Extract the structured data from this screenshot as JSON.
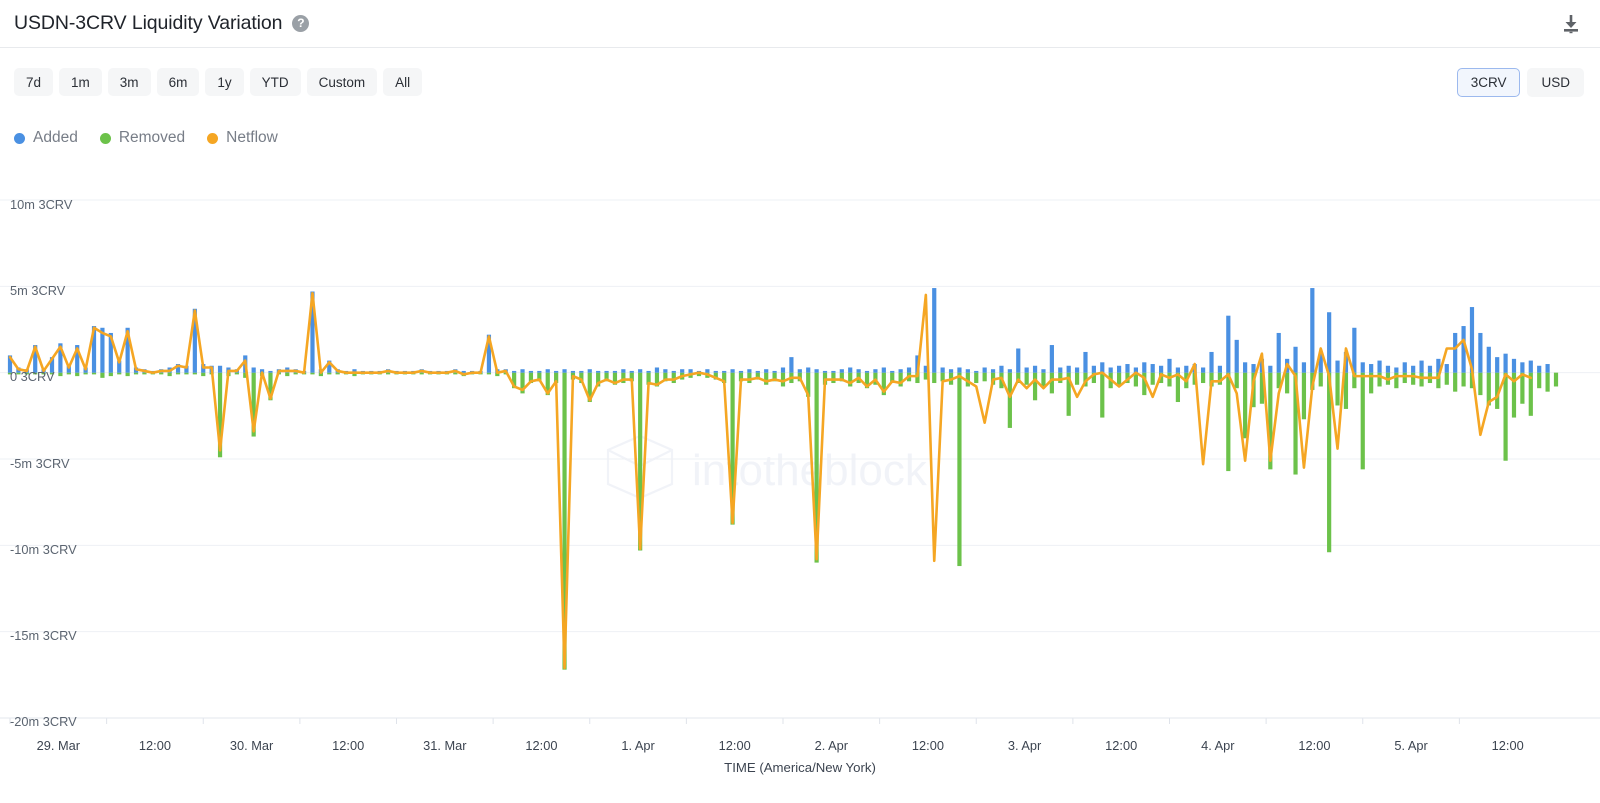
{
  "header": {
    "title": "USDN-3CRV Liquidity Variation",
    "help_icon": "help-circle-icon",
    "download_icon": "download-icon"
  },
  "controls": {
    "ranges": [
      {
        "label": "7d",
        "active": false
      },
      {
        "label": "1m",
        "active": false
      },
      {
        "label": "3m",
        "active": false
      },
      {
        "label": "6m",
        "active": false
      },
      {
        "label": "1y",
        "active": false
      },
      {
        "label": "YTD",
        "active": false
      },
      {
        "label": "Custom",
        "active": false
      },
      {
        "label": "All",
        "active": false
      }
    ],
    "units": [
      {
        "label": "3CRV",
        "active": true
      },
      {
        "label": "USD",
        "active": false
      }
    ]
  },
  "legend": [
    {
      "label": "Added",
      "color": "#4a90e2"
    },
    {
      "label": "Removed",
      "color": "#6cc24a"
    },
    {
      "label": "Netflow",
      "color": "#f5a623"
    }
  ],
  "watermark": {
    "text": "intotheblock",
    "color": "#f2f4f8"
  },
  "colors": {
    "added": "#4a90e2",
    "removed": "#6cc24a",
    "netflow": "#f5a623",
    "grid": "#eef0f4",
    "axis_text": "#3c4450",
    "background": "#ffffff"
  },
  "chart_data": {
    "type": "bar",
    "title": "USDN-3CRV Liquidity Variation",
    "subtitle": "",
    "xlabel": "TIME (America/New York)",
    "ylabel": "3CRV",
    "unit": "3CRV",
    "timezone": "America/New York",
    "grid": true,
    "legend_position": "top-left",
    "ylim": [
      -20000000,
      10000000
    ],
    "ytick_values": [
      10000000,
      5000000,
      0,
      -5000000,
      -10000000,
      -15000000,
      -20000000
    ],
    "ytick_labels": [
      "10m 3CRV",
      "5m 3CRV",
      "0 3CRV",
      "-5m 3CRV",
      "-10m 3CRV",
      "-15m 3CRV",
      "-20m 3CRV"
    ],
    "xtick_labels": [
      "29. Mar",
      "12:00",
      "30. Mar",
      "12:00",
      "31. Mar",
      "12:00",
      "1. Apr",
      "12:00",
      "2. Apr",
      "12:00",
      "3. Apr",
      "12:00",
      "4. Apr",
      "12:00",
      "5. Apr",
      "12:00"
    ],
    "x_start": "29. Mar 00:00",
    "x_end": "5. Apr 23:00",
    "x_interval_hours": 1,
    "n_points": 190,
    "series": [
      {
        "name": "Added",
        "type": "bar",
        "color": "#4a90e2",
        "values": [
          1000000,
          300000,
          200000,
          1600000,
          200000,
          900000,
          1700000,
          400000,
          1600000,
          300000,
          2700000,
          2600000,
          2300000,
          700000,
          2600000,
          300000,
          200000,
          100000,
          200000,
          300000,
          500000,
          400000,
          3700000,
          500000,
          400000,
          400000,
          300000,
          200000,
          1000000,
          300000,
          200000,
          100000,
          200000,
          300000,
          200000,
          100000,
          4700000,
          200000,
          700000,
          200000,
          100000,
          200000,
          100000,
          100000,
          100000,
          200000,
          100000,
          100000,
          100000,
          200000,
          100000,
          100000,
          100000,
          200000,
          100000,
          100000,
          100000,
          2200000,
          200000,
          200000,
          100000,
          200000,
          100000,
          100000,
          200000,
          100000,
          200000,
          100000,
          100000,
          200000,
          100000,
          100000,
          100000,
          200000,
          100000,
          200000,
          100000,
          300000,
          200000,
          100000,
          200000,
          200000,
          100000,
          200000,
          100000,
          100000,
          200000,
          100000,
          200000,
          100000,
          200000,
          100000,
          300000,
          900000,
          200000,
          300000,
          200000,
          100000,
          100000,
          200000,
          300000,
          200000,
          100000,
          200000,
          300000,
          100000,
          200000,
          300000,
          1000000,
          400000,
          4900000,
          300000,
          200000,
          300000,
          200000,
          100000,
          300000,
          200000,
          400000,
          200000,
          1400000,
          300000,
          400000,
          200000,
          1600000,
          300000,
          400000,
          300000,
          1200000,
          400000,
          600000,
          300000,
          400000,
          500000,
          300000,
          600000,
          500000,
          400000,
          800000,
          300000,
          400000,
          500000,
          300000,
          1200000,
          400000,
          3300000,
          1900000,
          600000,
          500000,
          800000,
          400000,
          2300000,
          800000,
          1500000,
          600000,
          4900000,
          1100000,
          3500000,
          700000,
          1200000,
          2600000,
          600000,
          500000,
          700000,
          400000,
          300000,
          600000,
          400000,
          700000,
          400000,
          800000,
          500000,
          2300000,
          2700000,
          3800000,
          2300000,
          1500000,
          900000,
          1100000,
          800000,
          600000,
          700000,
          400000,
          500000
        ]
      },
      {
        "name": "Removed",
        "type": "bar",
        "color": "#6cc24a",
        "values": [
          -100000,
          -100000,
          -100000,
          -100000,
          -100000,
          -100000,
          -200000,
          -100000,
          -200000,
          -100000,
          -100000,
          -300000,
          -200000,
          -100000,
          -200000,
          -100000,
          -100000,
          -100000,
          -100000,
          -200000,
          -100000,
          -100000,
          -100000,
          -200000,
          -100000,
          -4900000,
          -200000,
          -100000,
          -300000,
          -3700000,
          -200000,
          -1600000,
          -100000,
          -200000,
          -100000,
          -100000,
          -100000,
          -200000,
          -100000,
          -100000,
          -100000,
          -200000,
          -100000,
          -100000,
          -100000,
          -100000,
          -100000,
          -100000,
          -100000,
          -100000,
          -100000,
          -100000,
          -100000,
          -100000,
          -200000,
          -100000,
          -100000,
          -100000,
          -200000,
          -100000,
          -900000,
          -1200000,
          -600000,
          -500000,
          -1300000,
          -600000,
          -17200000,
          -400000,
          -600000,
          -1700000,
          -800000,
          -500000,
          -700000,
          -600000,
          -500000,
          -10300000,
          -700000,
          -800000,
          -500000,
          -600000,
          -400000,
          -300000,
          -200000,
          -300000,
          -400000,
          -600000,
          -8800000,
          -500000,
          -600000,
          -400000,
          -700000,
          -500000,
          -800000,
          -600000,
          -500000,
          -1400000,
          -11000000,
          -700000,
          -600000,
          -500000,
          -800000,
          -600000,
          -900000,
          -700000,
          -1300000,
          -600000,
          -800000,
          -500000,
          -600000,
          -400000,
          -600000,
          -500000,
          -700000,
          -11200000,
          -800000,
          -600000,
          -500000,
          -700000,
          -900000,
          -3200000,
          -600000,
          -700000,
          -1600000,
          -800000,
          -1200000,
          -600000,
          -2500000,
          -700000,
          -800000,
          -600000,
          -2600000,
          -900000,
          -700000,
          -600000,
          -800000,
          -1300000,
          -700000,
          -600000,
          -800000,
          -1700000,
          -900000,
          -700000,
          -600000,
          -800000,
          -700000,
          -5700000,
          -900000,
          -3800000,
          -2000000,
          -1800000,
          -5600000,
          -900000,
          -1200000,
          -5900000,
          -2700000,
          -1000000,
          -800000,
          -10400000,
          -1900000,
          -2100000,
          -900000,
          -5600000,
          -1200000,
          -800000,
          -700000,
          -900000,
          -600000,
          -700000,
          -800000,
          -600000,
          -900000,
          -700000,
          -1100000,
          -800000,
          -900000,
          -1300000,
          -1900000,
          -2100000,
          -5100000,
          -2600000,
          -1800000,
          -2500000,
          -900000,
          -1100000,
          -800000
        ]
      },
      {
        "name": "Netflow",
        "type": "line",
        "color": "#f5a623",
        "values": [
          900000,
          200000,
          100000,
          1500000,
          100000,
          800000,
          1500000,
          300000,
          1400000,
          200000,
          2600000,
          2300000,
          2100000,
          600000,
          2400000,
          200000,
          100000,
          0,
          100000,
          100000,
          400000,
          300000,
          3600000,
          300000,
          300000,
          -4500000,
          100000,
          100000,
          700000,
          -3400000,
          0,
          -1500000,
          100000,
          100000,
          100000,
          0,
          4600000,
          0,
          600000,
          100000,
          0,
          0,
          0,
          0,
          0,
          100000,
          0,
          0,
          0,
          100000,
          0,
          0,
          0,
          100000,
          -100000,
          0,
          0,
          2100000,
          0,
          100000,
          -800000,
          -1000000,
          -500000,
          -400000,
          -1200000,
          -500000,
          -17100000,
          -200000,
          -400000,
          -1600000,
          -600000,
          -400000,
          -600000,
          -400000,
          -400000,
          -10200000,
          -600000,
          -700000,
          -400000,
          -400000,
          -200000,
          -100000,
          0,
          -100000,
          -300000,
          -500000,
          -8700000,
          -400000,
          -400000,
          -300000,
          -500000,
          -400000,
          -500000,
          -300000,
          -300000,
          -1300000,
          -10800000,
          -400000,
          -400000,
          -400000,
          -600000,
          -300000,
          -800000,
          -400000,
          -1100000,
          -500000,
          -600000,
          -200000,
          -200000,
          4500000,
          -10900000,
          -500000,
          -400000,
          -200000,
          -500000,
          -800000,
          -2900000,
          -400000,
          -300000,
          -1400000,
          -400000,
          -900000,
          -400000,
          -900000,
          -400000,
          -400000,
          -300000,
          -1400000,
          -500000,
          -100000,
          0,
          -400000,
          -800000,
          -400000,
          0,
          -300000,
          -1400000,
          -100000,
          -300000,
          -100000,
          -500000,
          500000,
          -5300000,
          -500000,
          -500000,
          -100000,
          -1200000,
          -5100000,
          -500000,
          1100000,
          -5100000,
          -1200000,
          500000,
          -200000,
          -5500000,
          -800000,
          1400000,
          -200000,
          -4400000,
          1400000,
          -200000,
          -200000,
          -200000,
          -200000,
          -400000,
          -200000,
          -200000,
          -200000,
          -300000,
          -300000,
          -300000,
          1400000,
          1400000,
          1900000,
          200000,
          -3600000,
          -1700000,
          -1400000,
          -100000,
          -500000,
          -100000,
          -300000
        ]
      }
    ]
  }
}
